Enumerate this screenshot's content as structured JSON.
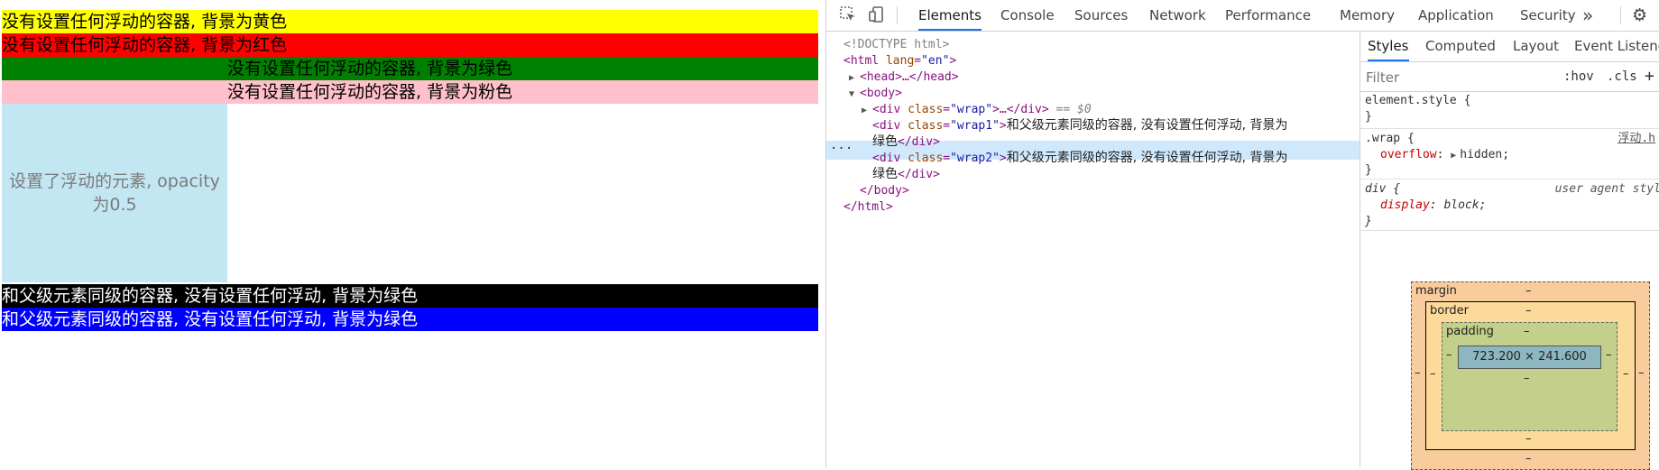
{
  "page": {
    "rows": [
      {
        "text": "没有设置任何浮动的容器, 背景为黄色",
        "bg": "#ffff00",
        "color": "#000000"
      },
      {
        "text": "没有设置任何浮动的容器, 背景为红色",
        "bg": "#ff0000",
        "color": "#000000"
      },
      {
        "text": "没有设置任何浮动的容器, 背景为绿色",
        "bg": "#008000",
        "color": "#000000"
      },
      {
        "text": "没有设置任何浮动的容器, 背景为粉色",
        "bg": "#ffc0cb",
        "color": "#000000"
      },
      {
        "text": "和父级元素同级的容器, 没有设置任何浮动, 背景为绿色",
        "bg": "#000000",
        "color": "#ffffff"
      },
      {
        "text": "和父级元素同级的容器, 没有设置任何浮动, 背景为绿色",
        "bg": "#0000ff",
        "color": "#ffffff"
      }
    ],
    "float_box": {
      "text": "设置了浮动的元素, opacity为0.5",
      "bg": "#c3e6f3"
    }
  },
  "devtools": {
    "tabs": [
      "Elements",
      "Console",
      "Sources",
      "Network",
      "Performance",
      "Memory",
      "Application",
      "Security"
    ],
    "active_tab": "Elements",
    "more_icon": "»",
    "settings_icon": "gear-icon",
    "dom": {
      "doctype": "<!DOCTYPE html>",
      "html_open": "<html",
      "html_attr": "lang",
      "html_val": "\"en\"",
      "head": "<head>…</head>",
      "body_open": "<body>",
      "wrap_tag": "div",
      "wrap_attr": "class",
      "wrap_val": "\"wrap\"",
      "wrap_rest": ">…</div>",
      "wrap_eq": "== $0",
      "wrap1_val": "\"wrap1\"",
      "wrap1_text_1": "和父级元素同级的容器, 没有设置任何浮动, 背景为",
      "wrap1_text_2": "绿色",
      "wrap2_val": "\"wrap2\"",
      "wrap2_text_1": "和父级元素同级的容器, 没有设置任何浮动, 背景为",
      "wrap2_text_2": "绿色",
      "close_div": "</div>",
      "body_close": "</body>",
      "html_close": "</html>",
      "dots": "···"
    },
    "styles": {
      "tabs": [
        "Styles",
        "Computed",
        "Layout",
        "Event Listeners"
      ],
      "active_tab": "Styles",
      "filter_placeholder": "Filter",
      "hov": ":hov",
      "cls": ".cls",
      "plus": "+",
      "element_style": "element.style {",
      "close_brace": "}",
      "wrap_selector": ".wrap {",
      "wrap_source": "浮动.h",
      "wrap_prop": "overflow",
      "wrap_value": "hidden;",
      "div_selector": "div {",
      "div_source": "user agent styl",
      "div_prop": "display",
      "div_value": "block;"
    },
    "box_model": {
      "margin_label": "margin",
      "border_label": "border",
      "padding_label": "padding",
      "content_size": "723.200 × 241.600",
      "dash": "–"
    }
  }
}
